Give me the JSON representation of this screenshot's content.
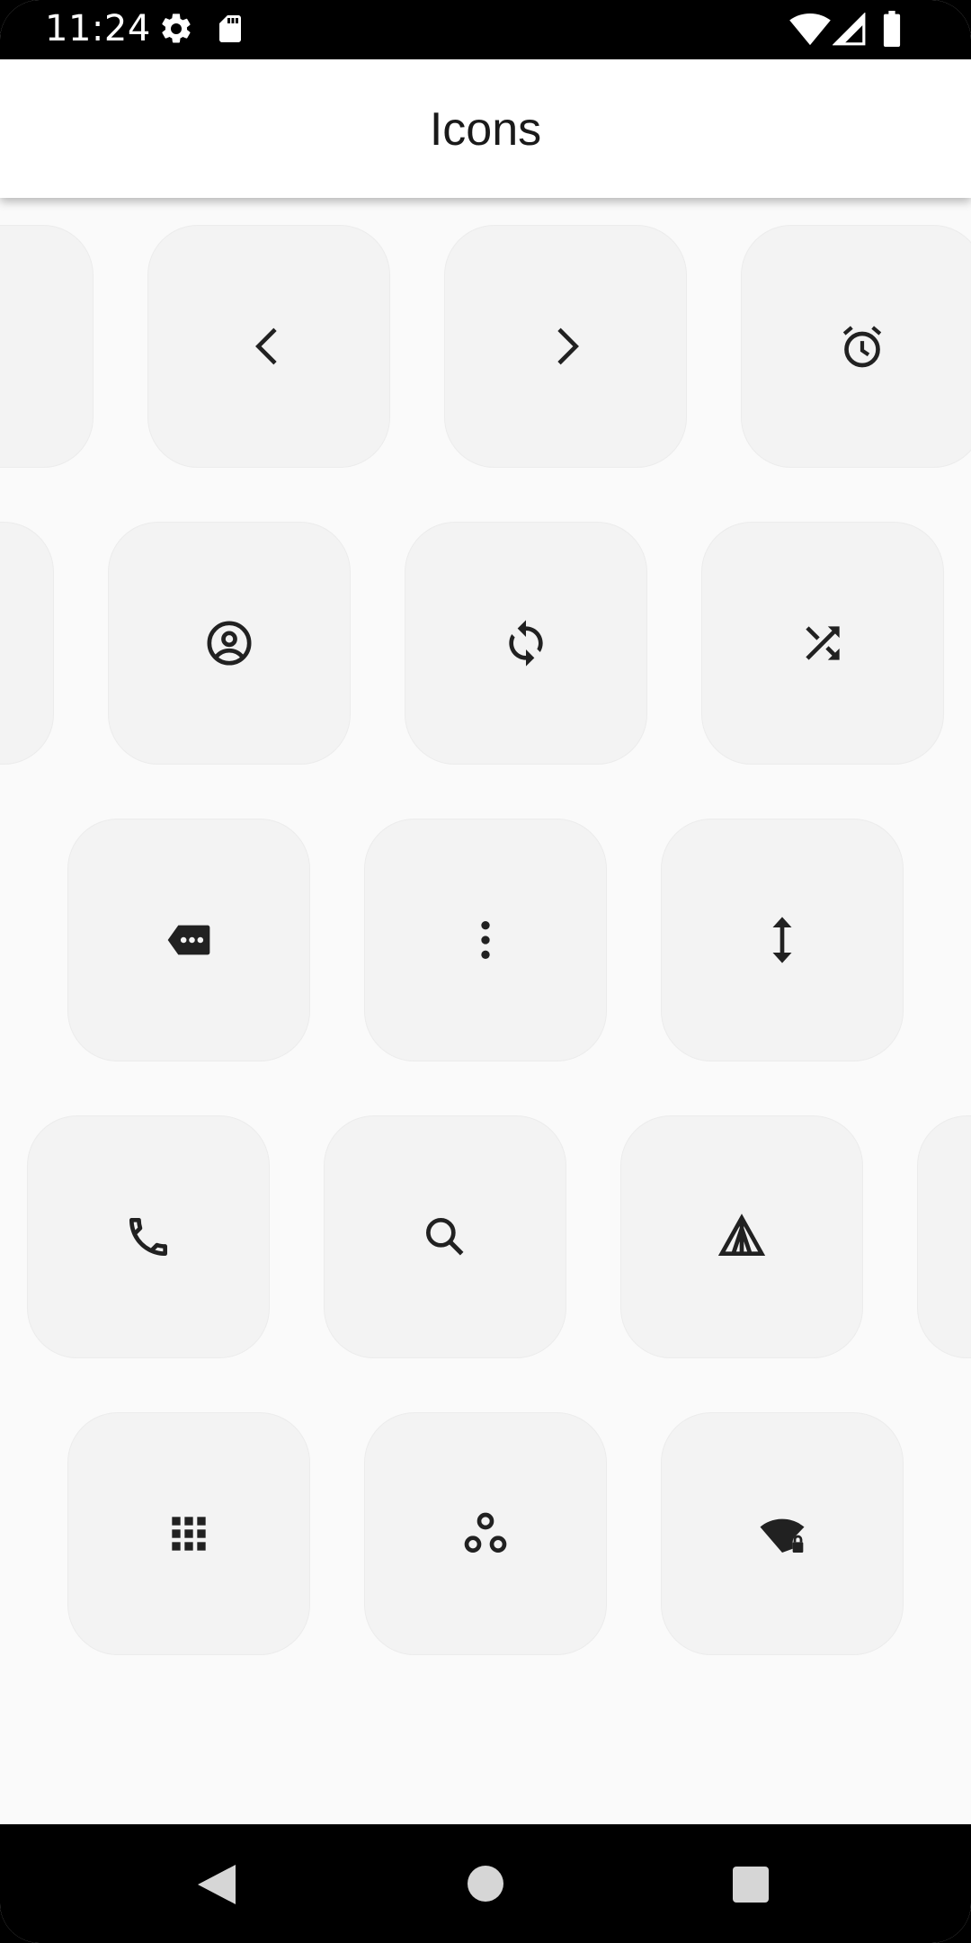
{
  "status_bar": {
    "time": "11:24",
    "icons": [
      "settings-icon",
      "sd-card-icon",
      "wifi-icon",
      "signal-icon",
      "battery-icon"
    ]
  },
  "app_bar": {
    "title": "Icons"
  },
  "grid": {
    "rows": [
      [
        "blank-icon",
        "chevron-left-icon",
        "chevron-right-icon",
        "alarm-icon"
      ],
      [
        "blank-icon",
        "account-circle-icon",
        "sync-icon",
        "shuffle-icon"
      ],
      [
        "label-more-icon",
        "more-vert-icon",
        "vertical-resize-icon"
      ],
      [
        "phone-icon",
        "search-icon",
        "tent-icon",
        "blank-icon"
      ],
      [
        "dialpad-icon",
        "workspaces-icon",
        "signal-wifi-lock-icon"
      ]
    ]
  },
  "nav_bar": {
    "buttons": [
      "back-icon",
      "home-icon",
      "recents-icon"
    ]
  },
  "colors": {
    "tile_bg": "#f3f3f3",
    "icon": "#212121",
    "page_bg": "#fafafa"
  }
}
